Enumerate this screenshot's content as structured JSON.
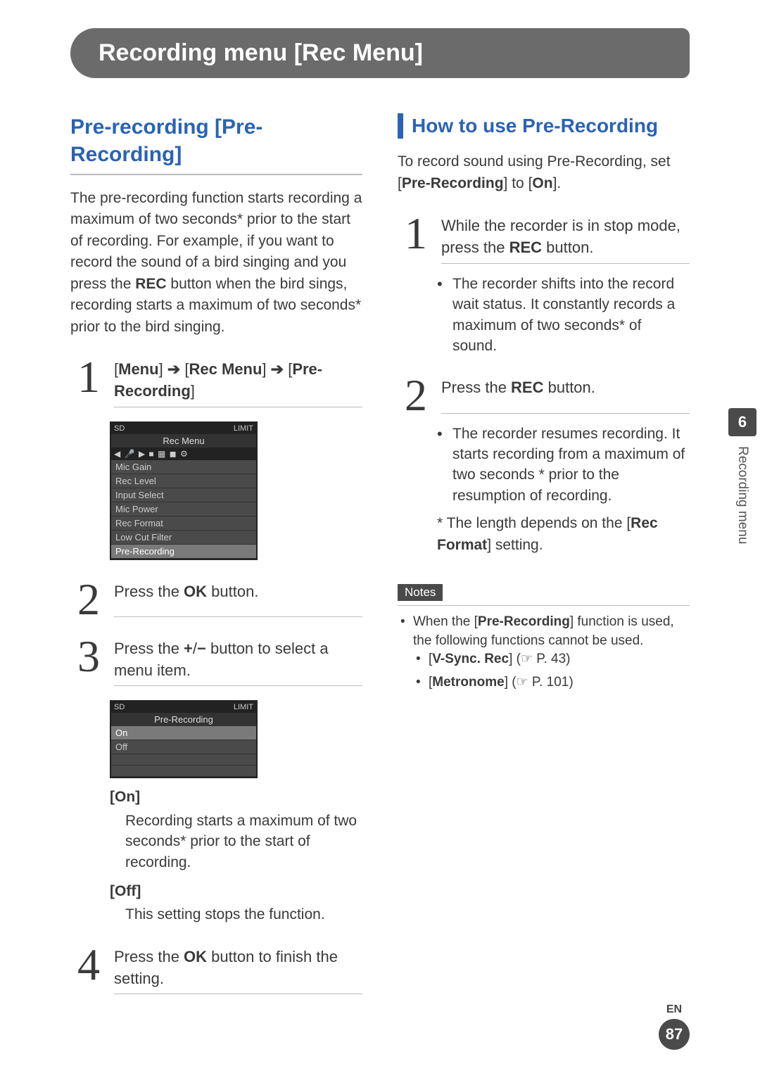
{
  "banner": "Recording menu [Rec Menu]",
  "leftTitle": "Pre-recording [Pre-Recording]",
  "intro_pre": "The pre-recording function starts recording a maximum of two seconds* prior to the start of recording. For example, if you want to record the sound of a bird singing and you press the ",
  "intro_rec": "REC",
  "intro_post": " button when the bird sings, recording starts a maximum of two seconds* prior to the bird singing.",
  "left_steps": {
    "s1": {
      "num": "1",
      "menu": "Menu",
      "rec_menu": "Rec Menu",
      "pre_rec": "Pre-Recording"
    },
    "s2": {
      "num": "2",
      "pre": "Press the ",
      "ok": "OK",
      "post": " button."
    },
    "s3": {
      "num": "3",
      "pre": "Press the ",
      "plus": "+",
      "slash": "/",
      "minus": "−",
      "post": " button to select a menu item."
    },
    "s4": {
      "num": "4",
      "pre": "Press the ",
      "ok": "OK",
      "post": " button to finish the setting."
    }
  },
  "lcd1": {
    "topL": "SD",
    "topR": "LIMIT",
    "title": "Rec Menu",
    "tabs": "◀ 🎤 ▶ ■ ▦ ◼ ⚙",
    "items": [
      "Mic Gain",
      "Rec Level",
      "Input Select",
      "Mic Power",
      "Rec Format",
      "Low Cut Filter",
      "Pre-Recording"
    ]
  },
  "lcd2": {
    "topL": "SD",
    "topR": "LIMIT",
    "title": "Pre-Recording",
    "items": [
      "On",
      "Off",
      "",
      ""
    ]
  },
  "options": {
    "on_label": "[On]",
    "on_desc": "Recording starts a maximum of two seconds* prior to the start of recording.",
    "off_label": "[Off]",
    "off_desc": "This setting stops the function."
  },
  "rightTitle": "How to use Pre-Recording",
  "right_intro_pre": "To record sound using Pre-Recording, set [",
  "right_intro_b1": "Pre-Recording",
  "right_intro_mid": "] to [",
  "right_intro_b2": "On",
  "right_intro_post": "].",
  "right_steps": {
    "s1": {
      "num": "1",
      "pre": "While the recorder is in stop mode, press the ",
      "rec": "REC",
      "post": " button.",
      "bullet": "The recorder shifts into the record wait status. It constantly records a maximum of two seconds* of sound."
    },
    "s2": {
      "num": "2",
      "pre": "Press the ",
      "rec": "REC",
      "post": " button.",
      "bullet1": "The recorder resumes recording. It starts recording from a maximum of two seconds * prior to the resumption of recording.",
      "star_pre": "*   The length depends on the [",
      "star_b": "Rec Format",
      "star_post": "] setting."
    }
  },
  "notes": {
    "badge": "Notes",
    "line1_pre": "When the [",
    "line1_b": "Pre-Recording",
    "line1_post": "] function is used, the following functions cannot be used.",
    "sub1_b": "V-Sync. Rec",
    "sub1_ref": "(☞ P. 43)",
    "sub2_b": "Metronome",
    "sub2_ref": "(☞ P. 101)"
  },
  "side": {
    "chapter": "6",
    "label": "Recording menu"
  },
  "footer": {
    "lang": "EN",
    "page": "87"
  }
}
